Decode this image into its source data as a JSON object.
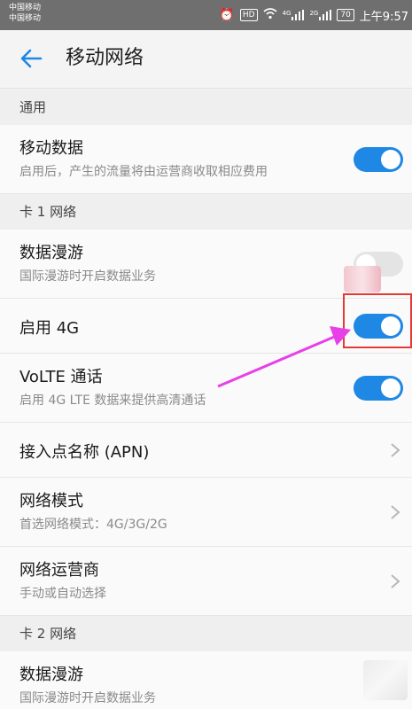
{
  "status_bar": {
    "carrier1": "中国移动",
    "carrier2": "中国移动",
    "network_4g": "4G",
    "network_2g": "2G",
    "battery": "70",
    "time": "上午9:57"
  },
  "header": {
    "title": "移动网络"
  },
  "sections": {
    "general": "通用",
    "card1": "卡 1 网络",
    "card2": "卡 2 网络"
  },
  "rows": {
    "mobile_data": {
      "title": "移动数据",
      "subtitle": "启用后，产生的流量将由运营商收取相应费用",
      "on": true
    },
    "roaming1": {
      "title": "数据漫游",
      "subtitle": "国际漫游时开启数据业务",
      "on": false
    },
    "enable4g": {
      "title": "启用 4G",
      "on": true
    },
    "volte": {
      "title": "VoLTE 通话",
      "subtitle": "启用 4G LTE 数据来提供高清通话",
      "on": true
    },
    "apn": {
      "title": "接入点名称 (APN)"
    },
    "network_mode": {
      "title": "网络模式",
      "subtitle": "首选网络模式：4G/3G/2G"
    },
    "operator": {
      "title": "网络运营商",
      "subtitle": "手动或自动选择"
    },
    "roaming2": {
      "title": "数据漫游",
      "subtitle": "国际漫游时开启数据业务"
    }
  },
  "colors": {
    "accent": "#1f88e5",
    "annotation_box": "#e53935",
    "annotation_arrow": "#e83fe8"
  },
  "icons": {
    "back": "arrow-left-icon",
    "chevron": "chevron-right-icon"
  }
}
